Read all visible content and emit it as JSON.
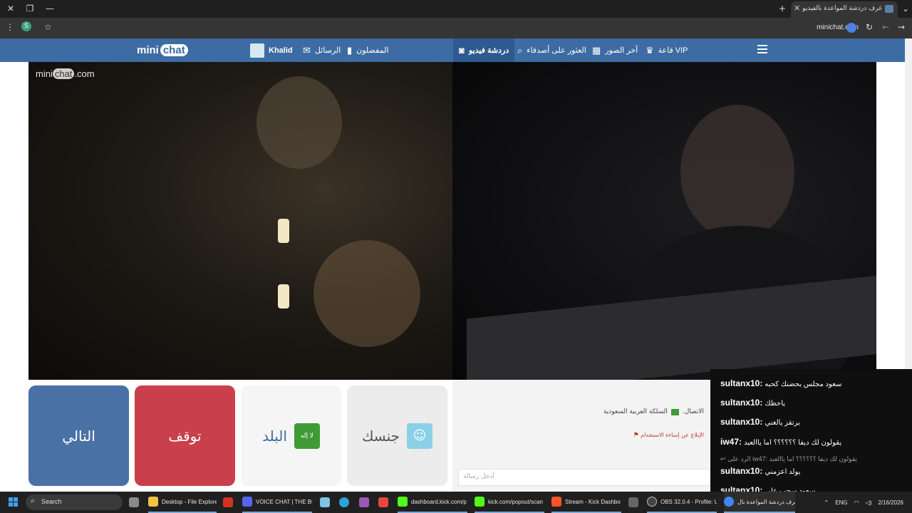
{
  "browser": {
    "tab_title": "غرف دردشة المواعدة بالفيديو",
    "url": "minichat.com",
    "profile_initial": "S"
  },
  "site": {
    "logo_main": "mini",
    "logo_chat": "chat",
    "nav": {
      "user_name": "Khalid",
      "messages": "الرسائل",
      "favorites": "المفضلون",
      "video_chat": "دردشة فيديو",
      "find_friends": "العثور على أصدقاء",
      "latest_photos": "آخر الصور",
      "vip": "قاعة VIP"
    },
    "video_watermark_main": "mini",
    "video_watermark_chat": "chat",
    "video_watermark_domain": ".com"
  },
  "controls": {
    "next_label": "التالي",
    "stop_label": "توقف",
    "country_label": "البلد",
    "country_flag_text": "لا إله",
    "gender_label": "جنسك"
  },
  "chat": {
    "status_text": "الاتصال.",
    "country_name": "السلكة العربية السعودية",
    "report_text": "الإبلاغ عن إساءة الاستخدام",
    "input_placeholder": "أدخل رسالة"
  },
  "kick_chat": {
    "messages": [
      {
        "user": "sultanx10:",
        "text": "سعود مجلس بحضنك كحبه"
      },
      {
        "user": "sultanx10:",
        "text": "ياحظك"
      },
      {
        "user": "sultanx10:",
        "text": "برتقز يالغني"
      },
      {
        "user": "iw47:",
        "text": "يقولون لك ديفا ؟؟؟؟؟؟ اما ياالعبد"
      },
      {
        "user": "sultanx10:",
        "text": "يولد اعزمني"
      },
      {
        "user": "sultanx10:",
        "text": "سعود سحب علي"
      }
    ],
    "reply": "الرد على iw47: يقولون لك ديفا ؟؟؟؟؟؟ اما ياالعبد"
  },
  "taskbar": {
    "search": "Search",
    "items": [
      {
        "label": "Desktop - File Explore",
        "color": "#f5c242"
      },
      {
        "label": "",
        "color": "#d93025"
      },
      {
        "label": "VOICE CHAT | THE BC",
        "color": "#5865f2"
      },
      {
        "label": "",
        "color": "#2aa3d8"
      },
      {
        "label": "",
        "color": "#e6483e"
      },
      {
        "label": "dashboard.kick.com/p",
        "color": "#53fc18"
      },
      {
        "label": "kick.com/popout/scan",
        "color": "#53fc18"
      },
      {
        "label": "Stream - Kick Dashbo",
        "color": "#fb542b"
      },
      {
        "label": "OBS 32.0.4 - Profile: Ur",
        "color": "#444444"
      },
      {
        "label": "عرف دردشة المواعدة بال",
        "color": "#4285f4"
      }
    ],
    "lang": "ENG",
    "date": "2/16/2026"
  }
}
